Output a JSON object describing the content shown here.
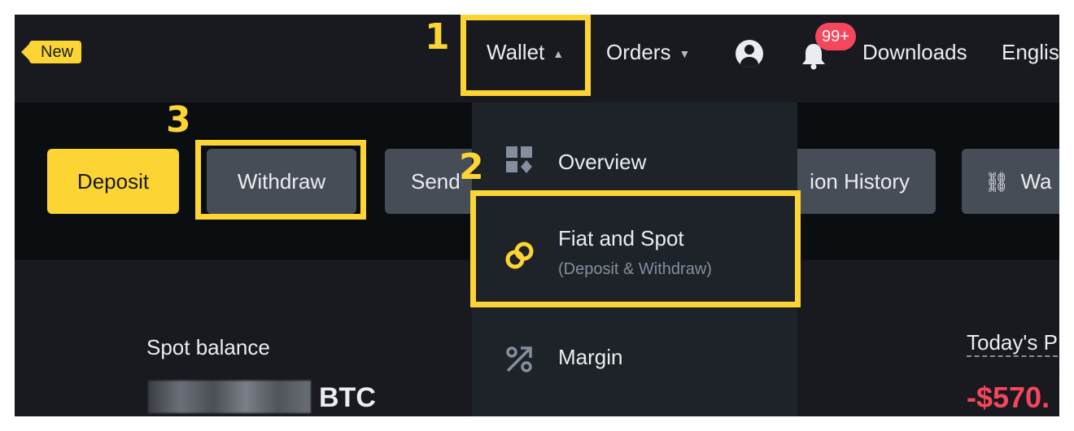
{
  "header": {
    "new_badge": "New",
    "nav": {
      "wallet": "Wallet",
      "orders": "Orders",
      "notifications_count": "99+",
      "downloads": "Downloads",
      "language": "Englis"
    }
  },
  "actions": {
    "deposit": "Deposit",
    "withdraw": "Withdraw",
    "send": "Send",
    "transaction_history": "ion History",
    "wallet_connect": "Wa"
  },
  "wallet_menu": {
    "items": [
      {
        "label": "Overview",
        "sub": ""
      },
      {
        "label": "Fiat and Spot",
        "sub": "(Deposit & Withdraw)"
      },
      {
        "label": "Margin",
        "sub": ""
      }
    ]
  },
  "balance": {
    "spot_label": "Spot balance",
    "currency": "BTC",
    "today_pnl_label": "Today's P",
    "today_pnl_value": "-$570."
  },
  "annotations": {
    "step1": "1",
    "step2": "2",
    "step3": "3"
  },
  "colors": {
    "accent": "#fcd535",
    "background": "#181a20",
    "negative": "#f6465d"
  }
}
